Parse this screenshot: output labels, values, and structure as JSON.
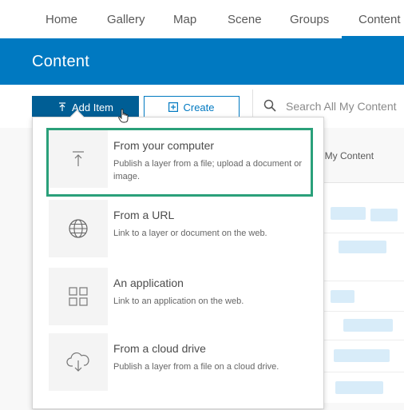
{
  "nav": {
    "items": [
      "Home",
      "Gallery",
      "Map",
      "Scene",
      "Groups",
      "Content"
    ],
    "active": "Content"
  },
  "banner": {
    "title": "Content"
  },
  "toolbar": {
    "add_item_label": "Add Item",
    "create_label": "Create",
    "search_placeholder": "Search All My Content"
  },
  "background": {
    "label": "ll My Content"
  },
  "dropdown": {
    "options": [
      {
        "title": "From your computer",
        "desc": "Publish a layer from a file; upload a document or image.",
        "icon": "upload-icon"
      },
      {
        "title": "From a URL",
        "desc": "Link to a layer or document on the web.",
        "icon": "globe-icon"
      },
      {
        "title": "An application",
        "desc": "Link to an application on the web.",
        "icon": "apps-grid-icon"
      },
      {
        "title": "From a cloud drive",
        "desc": "Publish a layer from a file on a cloud drive.",
        "icon": "cloud-download-icon"
      }
    ]
  },
  "colors": {
    "brand": "#0079c1",
    "highlight": "#2aa07a"
  }
}
